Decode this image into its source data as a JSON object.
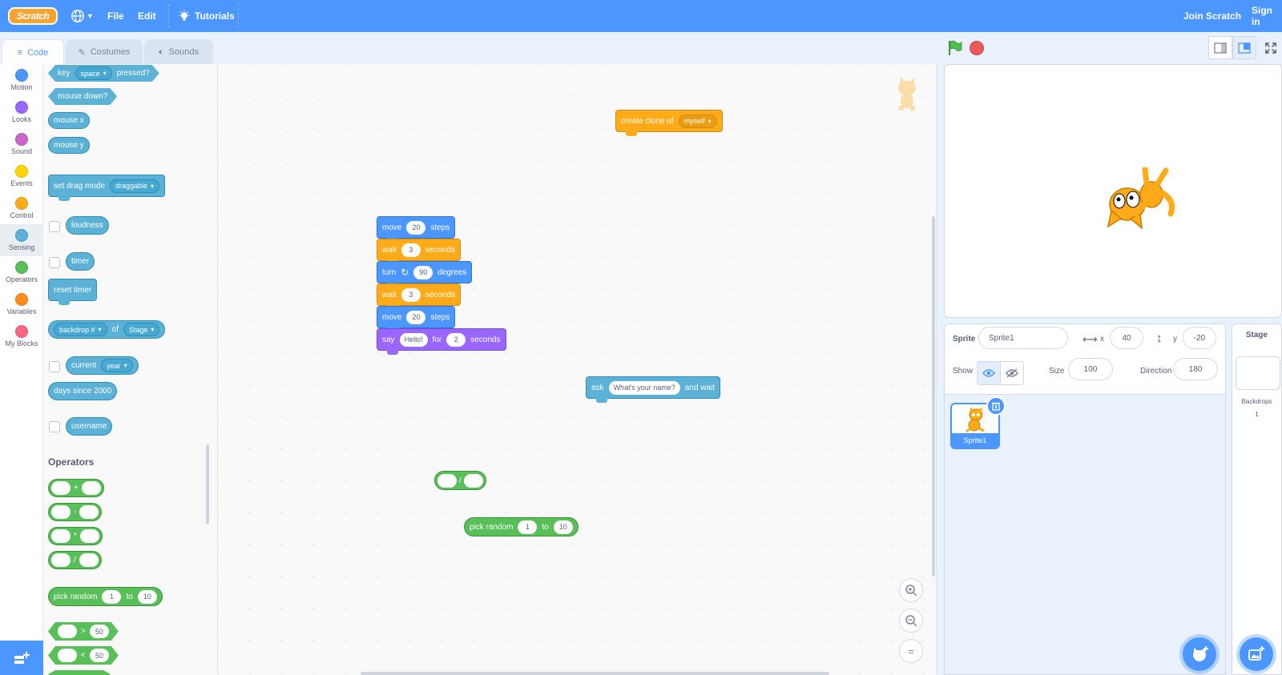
{
  "menubar": {
    "logo": "Scratch",
    "file": "File",
    "edit": "Edit",
    "tutorials": "Tutorials",
    "join": "Join Scratch",
    "signin": "Sign in"
  },
  "tabs": {
    "code": "Code",
    "costumes": "Costumes",
    "sounds": "Sounds"
  },
  "categories": [
    {
      "label": "Motion",
      "color": "#4c97ff"
    },
    {
      "label": "Looks",
      "color": "#9966ff"
    },
    {
      "label": "Sound",
      "color": "#cf63cf"
    },
    {
      "label": "Events",
      "color": "#ffd500"
    },
    {
      "label": "Control",
      "color": "#ffab19"
    },
    {
      "label": "Sensing",
      "color": "#5cb1d6"
    },
    {
      "label": "Operators",
      "color": "#59c059"
    },
    {
      "label": "Variables",
      "color": "#ff8c1a"
    },
    {
      "label": "My Blocks",
      "color": "#ff6680"
    }
  ],
  "palette": {
    "key_pressed": {
      "key": "key",
      "value": "space",
      "pressed": "pressed?"
    },
    "mouse_down": "mouse down?",
    "mouse_x": "mouse x",
    "mouse_y": "mouse y",
    "drag_mode": {
      "label": "set drag mode",
      "value": "draggable"
    },
    "loudness": "loudness",
    "timer": "timer",
    "reset_timer": "reset timer",
    "backdrop_of": {
      "value": "backdrop #",
      "of": "of",
      "target": "Stage"
    },
    "current": {
      "label": "current",
      "value": "year"
    },
    "days_since": "days since 2000",
    "username": "username",
    "operators_heading": "Operators",
    "op_plus": "+",
    "op_minus": "-",
    "op_times": "*",
    "op_div": "/",
    "pick_random": {
      "label": "pick random",
      "from": "1",
      "to_label": "to",
      "to": "10"
    },
    "gt": {
      "op": ">",
      "value": "50"
    },
    "lt": {
      "op": "<",
      "value": "50"
    }
  },
  "script": {
    "clone": {
      "label": "create clone of",
      "value": "myself"
    },
    "move1": {
      "label": "move",
      "value": "20",
      "unit": "steps"
    },
    "wait1": {
      "label": "wait",
      "value": "3",
      "unit": "seconds"
    },
    "turn": {
      "label": "turn",
      "value": "90",
      "unit": "degrees"
    },
    "wait2": {
      "label": "wait",
      "value": "3",
      "unit": "seconds"
    },
    "move2": {
      "label": "move",
      "value": "20",
      "unit": "steps"
    },
    "say": {
      "label": "say",
      "text": "Hello!",
      "for_label": "for",
      "secs": "2",
      "unit": "seconds"
    },
    "ask": {
      "label": "ask",
      "question": "What's your name?",
      "suffix": "and wait"
    },
    "divide": {
      "op": "/"
    },
    "random": {
      "label": "pick random",
      "from": "1",
      "to_label": "to",
      "to": "10"
    }
  },
  "zoom": {
    "in": "+",
    "out": "−",
    "reset": "="
  },
  "sprite": {
    "sprite_label": "Sprite",
    "name": "Sprite1",
    "x_label": "x",
    "x": "40",
    "y_label": "y",
    "y": "-20",
    "show_label": "Show",
    "size_label": "Size",
    "size": "100",
    "direction_label": "Direction",
    "direction": "180",
    "tile_name": "Sprite1"
  },
  "stage_pane": {
    "title": "Stage",
    "backdrops_label": "Backdrops",
    "backdrops_count": "1"
  }
}
